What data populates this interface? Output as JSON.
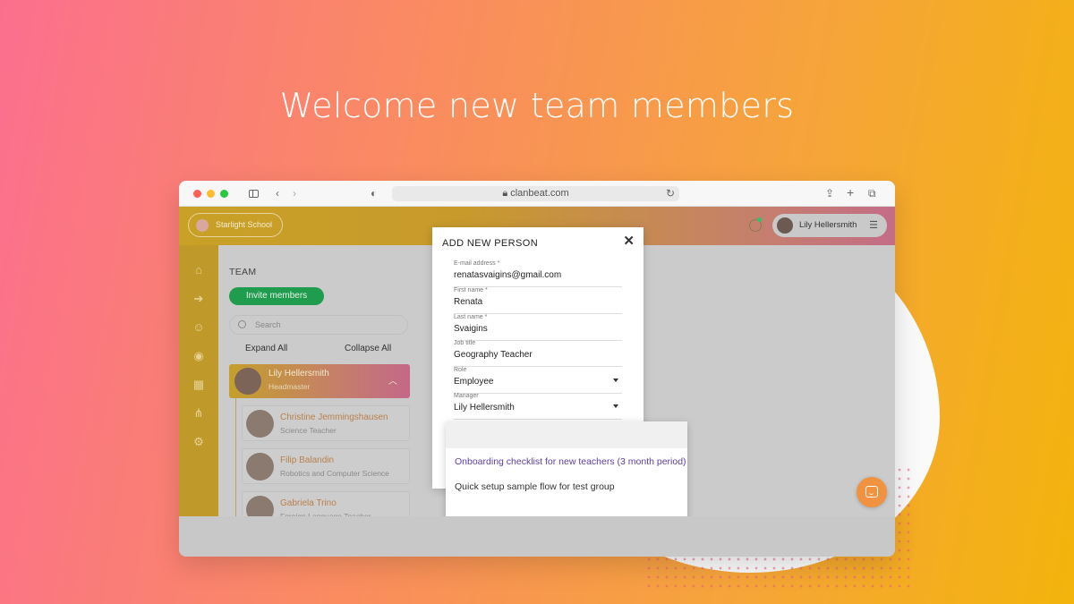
{
  "headline": "Welcome new team members",
  "browser": {
    "url": "clanbeat.com"
  },
  "app": {
    "org_name": "Starlight School",
    "user_name": "Lily Hellersmith"
  },
  "team": {
    "title": "TEAM",
    "invite_label": "Invite members",
    "search_placeholder": "Search",
    "expand_all": "Expand All",
    "collapse_all": "Collapse All",
    "lead": {
      "name": "Lily Hellersmith",
      "role": "Headmaster"
    },
    "members": [
      {
        "name": "Christine Jemmingshausen",
        "role": "Science Teacher"
      },
      {
        "name": "Filip Balandin",
        "role": "Robotics and Computer Science"
      },
      {
        "name": "Gabriela Trino",
        "role": "Foreign Language Teacher"
      }
    ]
  },
  "modal": {
    "title": "ADD NEW PERSON",
    "fields": [
      {
        "label": "E-mail address *",
        "value": "renatasvaigins@gmail.com"
      },
      {
        "label": "First name *",
        "value": "Renata"
      },
      {
        "label": "Last name *",
        "value": "Svaigins"
      },
      {
        "label": "Job title",
        "value": "Geography Teacher"
      },
      {
        "label": "Role",
        "value": "Employee"
      },
      {
        "label": "Manager",
        "value": "Lily Hellersmith"
      }
    ],
    "dropdown_options": [
      "Onboarding checklist for new teachers (3 month period)",
      "Quick setup sample flow for test group"
    ]
  },
  "colors": {
    "accent_green": "#1f9c4e",
    "selected_option": "#5d3fa0",
    "chat_orange": "#f0923f"
  }
}
